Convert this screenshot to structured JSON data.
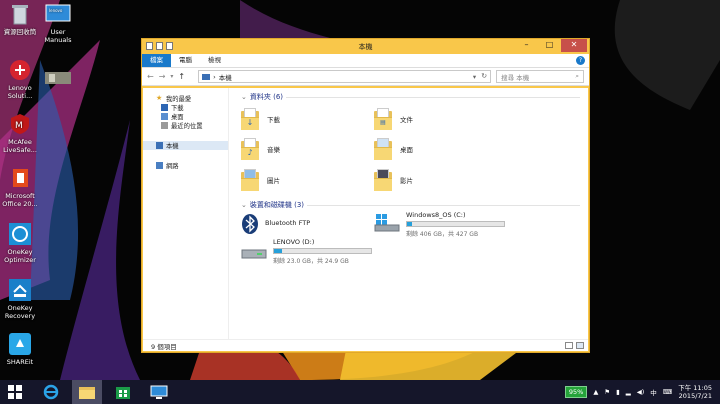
{
  "desktop": {
    "icons": [
      {
        "label": "資源回收筒",
        "icon": "recycle-bin-icon"
      },
      {
        "label": "User Manuals",
        "icon": "manual-icon"
      },
      {
        "label": "Lenovo Soluti...",
        "icon": "lenovo-icon"
      },
      {
        "label": "McAfee LiveSafe...",
        "icon": "mcafee-icon"
      },
      {
        "label": "Microsoft Office 20...",
        "icon": "office-icon"
      },
      {
        "label": "OneKey Optimizer",
        "icon": "optimizer-icon"
      },
      {
        "label": "OneKey Recovery",
        "icon": "recovery-icon"
      },
      {
        "label": "SHAREit",
        "icon": "shareit-icon"
      }
    ]
  },
  "window": {
    "title": "本機",
    "ribbon_tabs": [
      "檔案",
      "電腦",
      "檢視"
    ],
    "address": "本機",
    "search_placeholder": "搜尋 本機",
    "nav_pane": {
      "favorites": "我的最愛",
      "downloads": "下載",
      "desktop": "桌面",
      "recent": "最近的位置",
      "this_pc": "本機",
      "network": "網路"
    },
    "folders_group": "資料夾 (6)",
    "folders": [
      "下載",
      "文件",
      "音樂",
      "桌面",
      "圖片",
      "影片"
    ],
    "devices_group": "裝置和磁碟機 (3)",
    "devices": {
      "bluetooth": "Bluetooth FTP",
      "c_drive": {
        "name": "Windows8_OS (C:)",
        "free": "剩餘 406 GB，共 427 GB",
        "used_fraction": 0.05
      },
      "d_drive": {
        "name": "LENOVO (D:)",
        "free": "剩餘 23.0 GB，共 24.9 GB",
        "used_fraction": 0.08
      }
    },
    "status": "9 個項目"
  },
  "taskbar": {
    "battery": "95%",
    "ime": "中",
    "time": "下午 11:05",
    "date": "2015/7/21"
  },
  "colors": {
    "accent": "#1979ca",
    "window_frame": "#f9c74a",
    "taskbar": "#15162a"
  }
}
